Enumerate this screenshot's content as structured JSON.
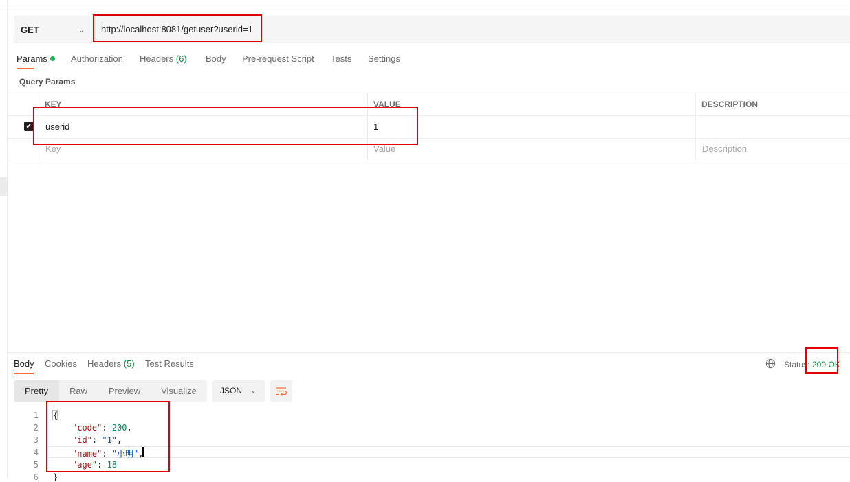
{
  "request": {
    "method": "GET",
    "url": "http://localhost:8081/getuser?userid=1",
    "tabs": [
      {
        "label": "Params",
        "active": true,
        "dot": true
      },
      {
        "label": "Authorization"
      },
      {
        "label": "Headers",
        "count": "(6)"
      },
      {
        "label": "Body"
      },
      {
        "label": "Pre-request Script"
      },
      {
        "label": "Tests"
      },
      {
        "label": "Settings"
      }
    ],
    "query_params_label": "Query Params",
    "table": {
      "headers": {
        "key": "KEY",
        "value": "VALUE",
        "description": "DESCRIPTION"
      },
      "rows": [
        {
          "checked": true,
          "key": "userid",
          "value": "1",
          "description": ""
        }
      ],
      "placeholders": {
        "key": "Key",
        "value": "Value",
        "description": "Description"
      }
    }
  },
  "response": {
    "tabs": [
      {
        "label": "Body",
        "active": true
      },
      {
        "label": "Cookies"
      },
      {
        "label": "Headers",
        "count": "(5)"
      },
      {
        "label": "Test Results"
      }
    ],
    "status_label": "Status:",
    "status_value": "200 OK",
    "format_buttons": [
      "Pretty",
      "Raw",
      "Preview",
      "Visualize"
    ],
    "format_select": "JSON",
    "line_numbers": [
      "1",
      "2",
      "3",
      "4",
      "5",
      "6"
    ],
    "code": [
      {
        "open": "{"
      },
      {
        "key": "\"code\"",
        "value": "200",
        "type": "number",
        "comma": ","
      },
      {
        "key": "\"id\"",
        "value": "\"1\"",
        "type": "string",
        "comma": ","
      },
      {
        "key": "\"name\"",
        "value": "\"小明\"",
        "type": "string",
        "comma": ","
      },
      {
        "key": "\"age\"",
        "value": "18",
        "type": "number",
        "comma": ""
      },
      {
        "close": "}"
      }
    ]
  },
  "colors": {
    "accent": "#ff6c37",
    "annotation": "#e00000",
    "status_ok": "#0d8d3d"
  }
}
